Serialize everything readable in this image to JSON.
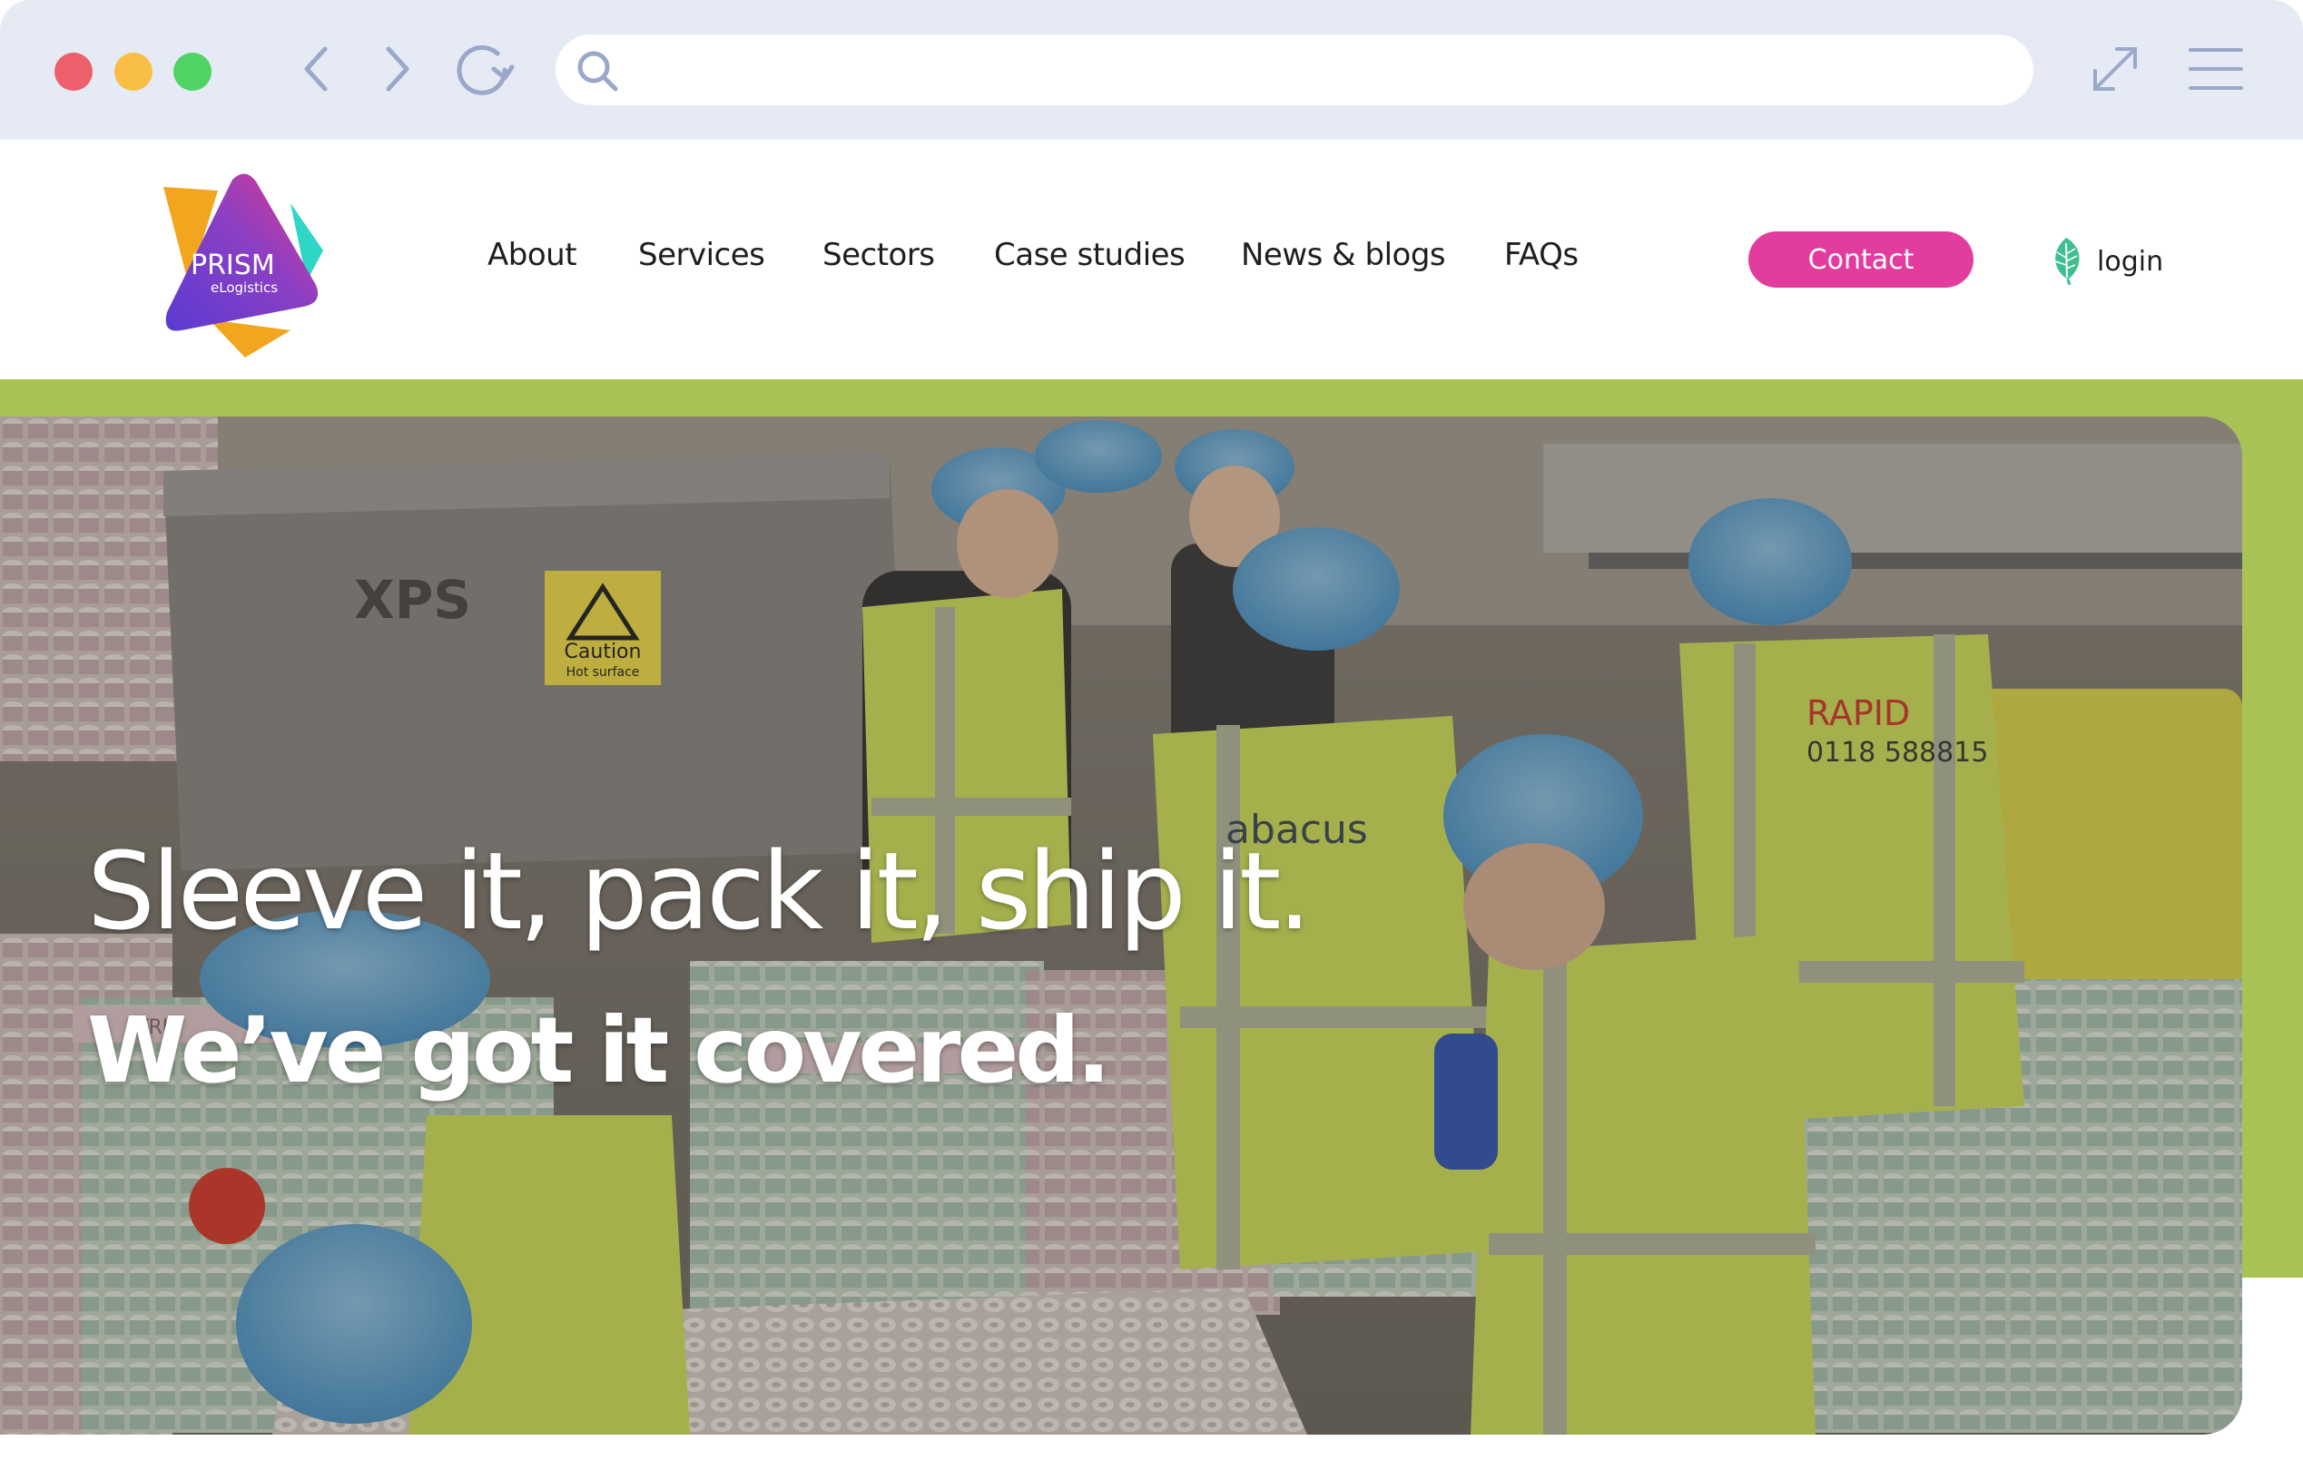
{
  "browser": {
    "address_value": "",
    "icons": [
      "back-icon",
      "forward-icon",
      "reload-icon",
      "search-icon",
      "expand-icon",
      "menu-icon"
    ]
  },
  "logo": {
    "name": "PRISM",
    "tagline": "eLogistics",
    "colors": {
      "purple": "#7b3fc7",
      "magenta": "#d93c98",
      "teal": "#2ed6c6",
      "orange": "#f2a51f"
    }
  },
  "nav": {
    "items": [
      {
        "label": "About"
      },
      {
        "label": "Services"
      },
      {
        "label": "Sectors"
      },
      {
        "label": "Case studies"
      },
      {
        "label": "News & blogs"
      },
      {
        "label": "FAQs"
      }
    ],
    "contact_label": "Contact",
    "login_label": "login"
  },
  "hero": {
    "line1": "Sleeve it, pack it, ship it.",
    "line2": "We’ve got it covered.",
    "photo_signs": {
      "machine_brand": "XPS",
      "caution_title": "Caution",
      "caution_sub": "Hot surface",
      "vest_text_1": "abacus",
      "vest_text_2": "RAPID",
      "vest_text_3": "0118 588815",
      "box_label": "TRIP"
    }
  },
  "colors": {
    "chrome_bg": "#e5eaf4",
    "accent_pink": "#e23c9e",
    "accent_green": "#a9c255",
    "login_leaf": "#3fbf8f"
  }
}
